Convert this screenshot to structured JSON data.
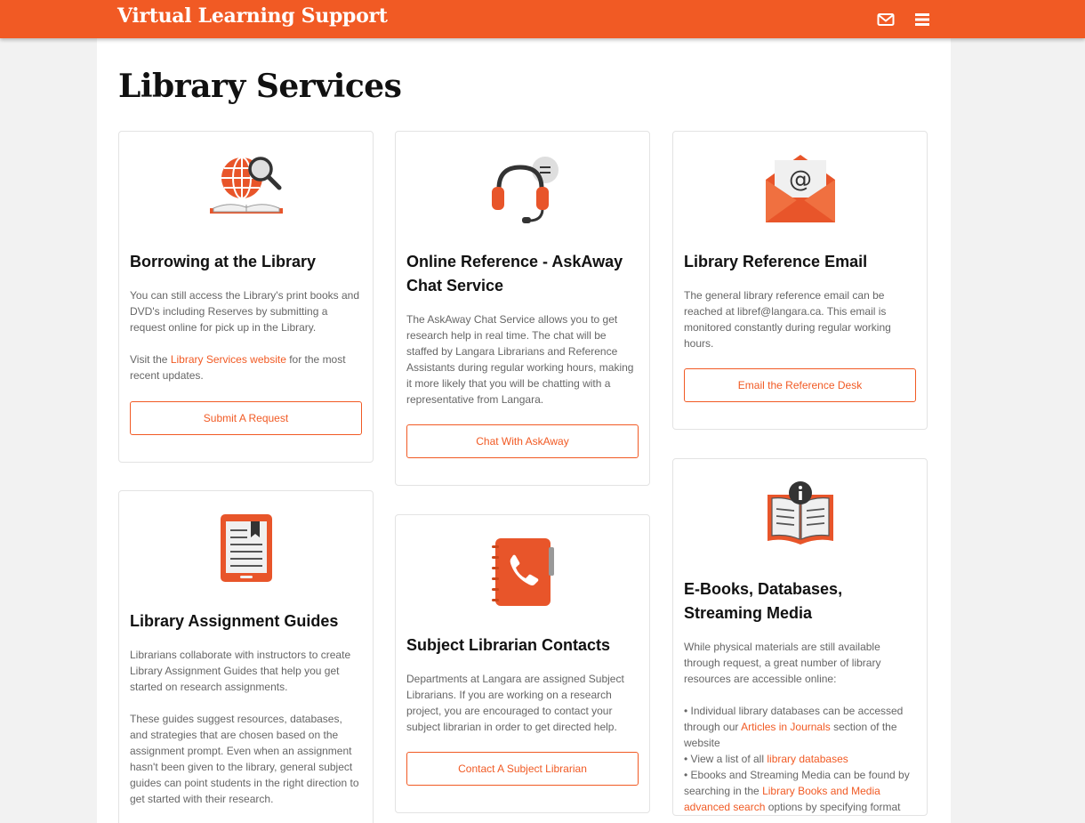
{
  "header": {
    "brand": "Virtual Learning Support",
    "icons": [
      "envelope-icon",
      "hamburger-menu-icon"
    ]
  },
  "page": {
    "title": "Library Services"
  },
  "colors": {
    "accent": "#f15a24",
    "text": "#666666",
    "heading": "#111111",
    "background": "#f2f2f2"
  },
  "cards": {
    "borrowing": {
      "icon": "globe-book-magnifier-icon",
      "title": "Borrowing at the Library",
      "p1": "You can still access the Library's print books and DVD's including Reserves by submitting a request online for pick up in the Library.",
      "p2_before": "Visit the ",
      "p2_link": "Library Services website",
      "p2_after": " for the most recent updates.",
      "button": "Submit A Request"
    },
    "askaway": {
      "icon": "headset-chat-icon",
      "title": "Online Reference - AskAway Chat Service",
      "p1": "The AskAway Chat Service allows you to get research help in real time. The chat will be staffed by Langara Librarians and Reference Assistants during regular working hours, making it more likely that you will be chatting with a representative from Langara.",
      "button": "Chat With AskAway"
    },
    "email": {
      "icon": "envelope-at-icon",
      "title": "Library Reference Email",
      "p1": "The general library reference email can be reached at libref@langara.ca. This email is monitored constantly during regular working hours.",
      "button": "Email the Reference Desk"
    },
    "guides": {
      "icon": "ereader-icon",
      "title": "Library Assignment Guides",
      "p1": "Librarians collaborate with instructors to create Library Assignment Guides that help you get started on research assignments.",
      "p2": "These guides suggest resources, databases, and strategies that are chosen based on the assignment prompt. Even when an assignment hasn't been given to the library, general subject guides can point students in the right direction to get started with their research."
    },
    "subject": {
      "icon": "phone-book-icon",
      "title": "Subject Librarian Contacts",
      "p1": "Departments at Langara are assigned Subject Librarians. If you are working on a research project, you are encouraged to contact your subject librarian in order to get directed help.",
      "button": "Contact A Subject Librarian"
    },
    "ebooks": {
      "icon": "info-book-icon",
      "title": "E-Books, Databases, Streaming Media",
      "p1": "While physical materials are still available through request, a great number of library resources are accessible online:",
      "b1_before": "• Individual library databases can be accessed through our ",
      "b1_link": "Articles in Journals",
      "b1_after": " section of the website",
      "b2_before": "• View a list of all ",
      "b2_link": "library databases",
      "b3_before": "• Ebooks and Streaming Media can be found by searching in the ",
      "b3_link": "Library Books and Media advanced search",
      "b3_after": " options by specifying format"
    }
  }
}
